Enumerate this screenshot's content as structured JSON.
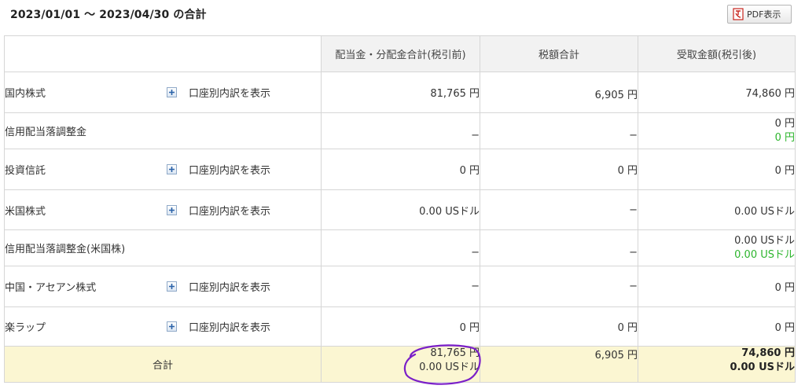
{
  "header": {
    "title": "2023/01/01 〜 2023/04/30 の合計",
    "pdf_button_label": "PDF表示"
  },
  "columns": [
    "配当金・分配金合計(税引前)",
    "税額合計",
    "受取金額(税引後)"
  ],
  "rows": [
    {
      "label": "国内株式",
      "breakdown": "口座別内訳を表示",
      "pretax": "81,765 円",
      "tax": "6,905 円",
      "net": "74,860 円",
      "net2": ""
    },
    {
      "label": "信用配当落調整金",
      "breakdown": "",
      "pretax": "−",
      "tax": "−",
      "net": "0 円",
      "net2": "0 円"
    },
    {
      "label": "投資信託",
      "breakdown": "口座別内訳を表示",
      "pretax": "0 円",
      "tax": "0 円",
      "net": "0 円",
      "net2": ""
    },
    {
      "label": "米国株式",
      "breakdown": "口座別内訳を表示",
      "pretax": "0.00 USドル",
      "tax": "−",
      "net": "0.00 USドル",
      "net2": ""
    },
    {
      "label": "信用配当落調整金(米国株)",
      "breakdown": "",
      "pretax": "−",
      "tax": "−",
      "net": "0.00 USドル",
      "net2": "0.00 USドル"
    },
    {
      "label": "中国・アセアン株式",
      "breakdown": "口座別内訳を表示",
      "pretax": "−",
      "tax": "−",
      "net": "0 円",
      "net2": ""
    },
    {
      "label": "楽ラップ",
      "breakdown": "口座別内訳を表示",
      "pretax": "0 円",
      "tax": "0 円",
      "net": "0 円",
      "net2": ""
    }
  ],
  "total": {
    "label": "合計",
    "pretax_yen": "81,765 円",
    "pretax_usd": "0.00 USドル",
    "tax": "6,905 円",
    "net_yen": "74,860 円",
    "net_usd": "0.00 USドル"
  },
  "colors": {
    "header_bg": "#f2f2f2",
    "total_bg": "#fbf6d2",
    "green_text": "#2db52d",
    "annotation_circle": "#7a1fc8"
  }
}
